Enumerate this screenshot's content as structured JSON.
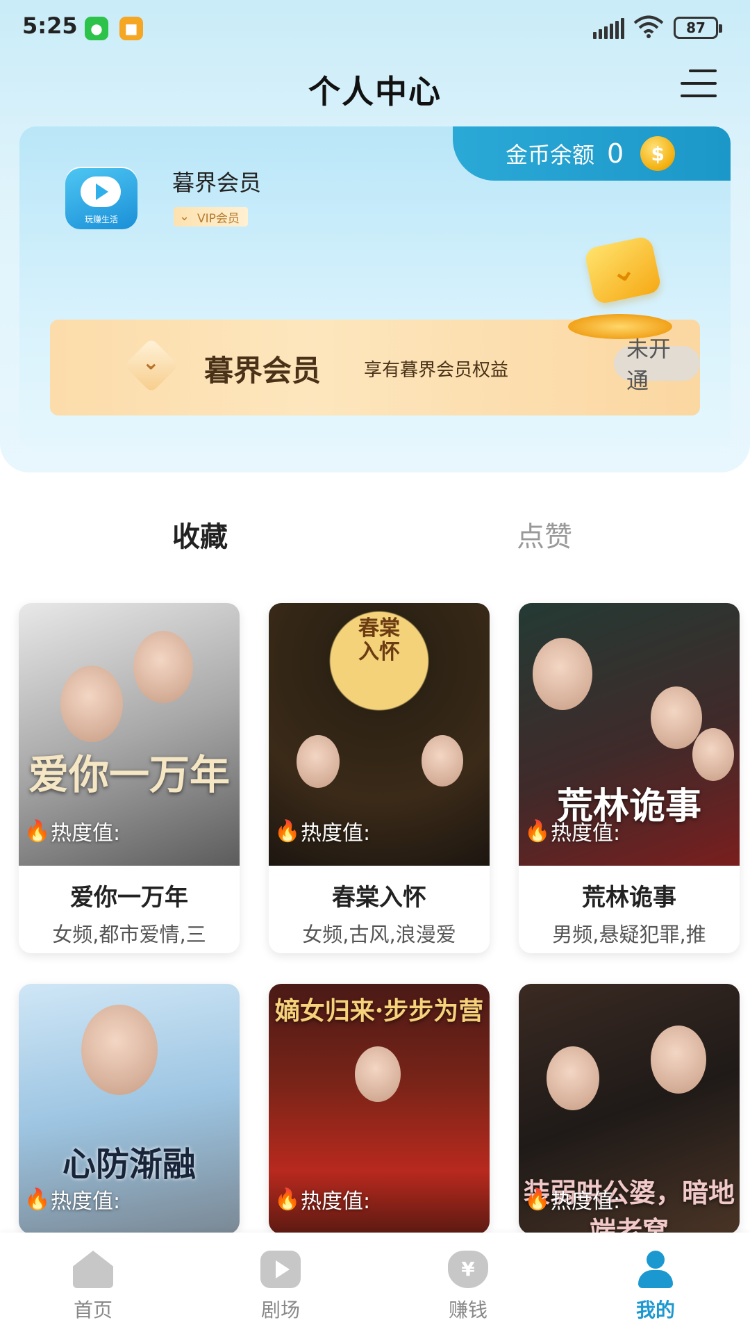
{
  "status_bar": {
    "time": "5:25",
    "battery": "87"
  },
  "header": {
    "title": "个人中心"
  },
  "member_card": {
    "coin_label": "金币余额",
    "coin_value": "0",
    "user_name": "暮界会员",
    "vip_tag": "VIP会员",
    "avatar_caption": "玩赚生活",
    "vip_bar_title": "暮界会员",
    "vip_bar_desc": "享有暮界会员权益",
    "vip_bar_status": "未开通"
  },
  "tabs": {
    "favorites": "收藏",
    "likes": "点赞"
  },
  "heat_label": "热度值:",
  "dramas": [
    {
      "title": "爱你一万年",
      "tags": "女频,都市爱情,三",
      "poster_text": "爱你一万年"
    },
    {
      "title": "春棠入怀",
      "tags": "女频,古风,浪漫爱",
      "poster_text": "春棠入怀"
    },
    {
      "title": "荒林诡事",
      "tags": "男频,悬疑犯罪,推",
      "poster_text": "荒林诡事"
    },
    {
      "title": "",
      "tags": "",
      "poster_text": "心防渐融"
    },
    {
      "title": "",
      "tags": "",
      "poster_text": "嫡女归来·步步为营"
    },
    {
      "title": "",
      "tags": "",
      "poster_text": "装弱哄公婆，暗地端老窝"
    }
  ],
  "bottom_nav": {
    "home": "首页",
    "theater": "剧场",
    "earn": "赚钱",
    "mine": "我的"
  },
  "colors": {
    "accent": "#1c98d0",
    "gold": "#f4b213"
  }
}
